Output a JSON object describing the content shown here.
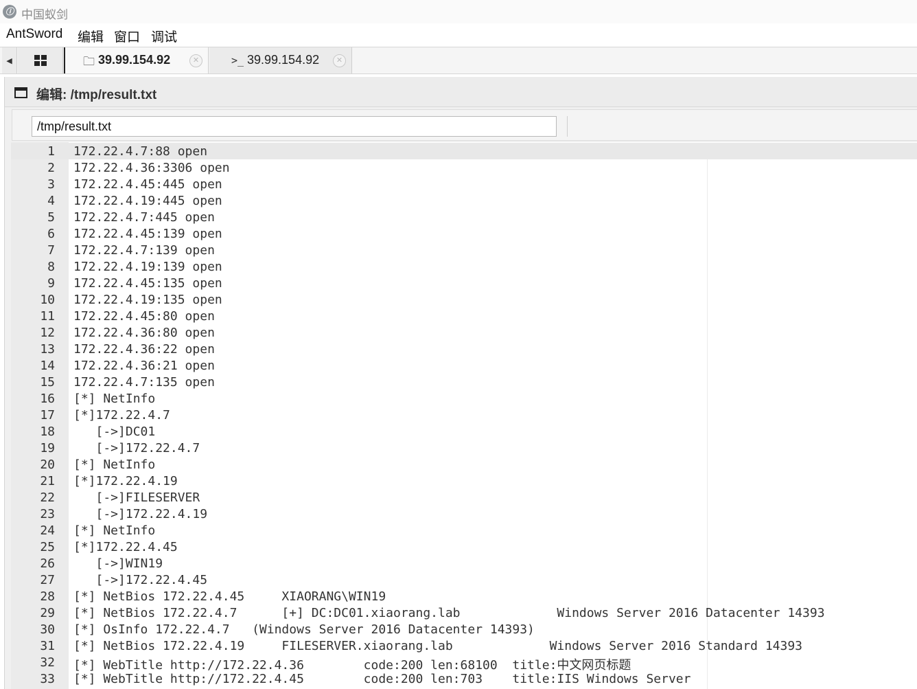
{
  "window": {
    "title": "中国蚁剑",
    "icon": "antsword-logo-icon"
  },
  "menu": {
    "items": [
      "AntSword",
      "编辑",
      "窗口",
      "调试"
    ]
  },
  "tabs": {
    "home_icon": "grid-icon",
    "items": [
      {
        "label": "39.99.154.92",
        "icon": "folder-icon",
        "active": true
      },
      {
        "label": "39.99.154.92",
        "icon": "terminal-icon",
        "active": false
      }
    ]
  },
  "editor_panel": {
    "title": "编辑: /tmp/result.txt",
    "path_value": "/tmp/result.txt"
  },
  "editor": {
    "active_line": 1,
    "lines": [
      {
        "n": "1",
        "text": "172.22.4.7:88 open"
      },
      {
        "n": "2",
        "text": "172.22.4.36:3306 open"
      },
      {
        "n": "3",
        "text": "172.22.4.45:445 open"
      },
      {
        "n": "4",
        "text": "172.22.4.19:445 open"
      },
      {
        "n": "5",
        "text": "172.22.4.7:445 open"
      },
      {
        "n": "6",
        "text": "172.22.4.45:139 open"
      },
      {
        "n": "7",
        "text": "172.22.4.7:139 open"
      },
      {
        "n": "8",
        "text": "172.22.4.19:139 open"
      },
      {
        "n": "9",
        "text": "172.22.4.45:135 open"
      },
      {
        "n": "10",
        "text": "172.22.4.19:135 open"
      },
      {
        "n": "11",
        "text": "172.22.4.45:80 open"
      },
      {
        "n": "12",
        "text": "172.22.4.36:80 open"
      },
      {
        "n": "13",
        "text": "172.22.4.36:22 open"
      },
      {
        "n": "14",
        "text": "172.22.4.36:21 open"
      },
      {
        "n": "15",
        "text": "172.22.4.7:135 open"
      },
      {
        "n": "16",
        "text": "[*] NetInfo"
      },
      {
        "n": "17",
        "text": "[*]172.22.4.7"
      },
      {
        "n": "18",
        "text": "   [->]DC01"
      },
      {
        "n": "19",
        "text": "   [->]172.22.4.7"
      },
      {
        "n": "20",
        "text": "[*] NetInfo"
      },
      {
        "n": "21",
        "text": "[*]172.22.4.19"
      },
      {
        "n": "22",
        "text": "   [->]FILESERVER"
      },
      {
        "n": "23",
        "text": "   [->]172.22.4.19"
      },
      {
        "n": "24",
        "text": "[*] NetInfo"
      },
      {
        "n": "25",
        "text": "[*]172.22.4.45"
      },
      {
        "n": "26",
        "text": "   [->]WIN19"
      },
      {
        "n": "27",
        "text": "   [->]172.22.4.45"
      },
      {
        "n": "28",
        "text": "[*] NetBios 172.22.4.45     XIAORANG\\WIN19"
      },
      {
        "n": "29",
        "text": "[*] NetBios 172.22.4.7      [+] DC:DC01.xiaorang.lab             Windows Server 2016 Datacenter 14393"
      },
      {
        "n": "30",
        "text": "[*] OsInfo 172.22.4.7   (Windows Server 2016 Datacenter 14393)"
      },
      {
        "n": "31",
        "text": "[*] NetBios 172.22.4.19     FILESERVER.xiaorang.lab             Windows Server 2016 Standard 14393"
      },
      {
        "n": "32",
        "text": "[*] WebTitle http://172.22.4.36        code:200 len:68100  title:中文网页标题"
      },
      {
        "n": "33",
        "text": "[*] WebTitle http://172.22.4.45        code:200 len:703    title:IIS Windows Server"
      }
    ]
  }
}
